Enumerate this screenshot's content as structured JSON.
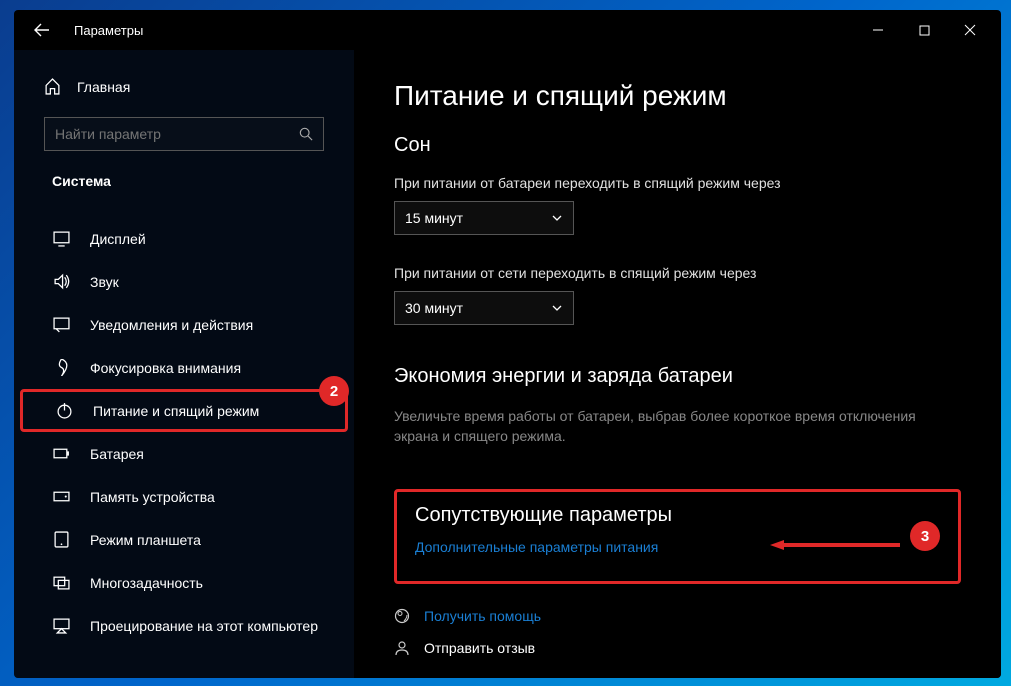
{
  "window": {
    "title": "Параметры"
  },
  "sidebar": {
    "home": "Главная",
    "search_placeholder": "Найти параметр",
    "section": "Система",
    "items": [
      {
        "label": "Дисплей"
      },
      {
        "label": "Звук"
      },
      {
        "label": "Уведомления и действия"
      },
      {
        "label": "Фокусировка внимания"
      },
      {
        "label": "Питание и спящий режим"
      },
      {
        "label": "Батарея"
      },
      {
        "label": "Память устройства"
      },
      {
        "label": "Режим планшета"
      },
      {
        "label": "Многозадачность"
      },
      {
        "label": "Проецирование на этот компьютер"
      }
    ]
  },
  "content": {
    "title": "Питание и спящий режим",
    "sleep_heading": "Сон",
    "battery_sleep_label": "При питании от батареи переходить в спящий режим через",
    "battery_sleep_value": "15 минут",
    "plugged_sleep_label": "При питании от сети переходить в спящий режим через",
    "plugged_sleep_value": "30 минут",
    "eco_heading": "Экономия энергии и заряда батареи",
    "eco_desc": "Увеличьте время работы от батареи, выбрав более короткое время отключения экрана и спящего режима.",
    "related_heading": "Сопутствующие параметры",
    "related_link": "Дополнительные параметры питания",
    "help_link": "Получить помощь",
    "feedback_link": "Отправить отзыв"
  },
  "annotations": {
    "badge2": "2",
    "badge3": "3"
  }
}
